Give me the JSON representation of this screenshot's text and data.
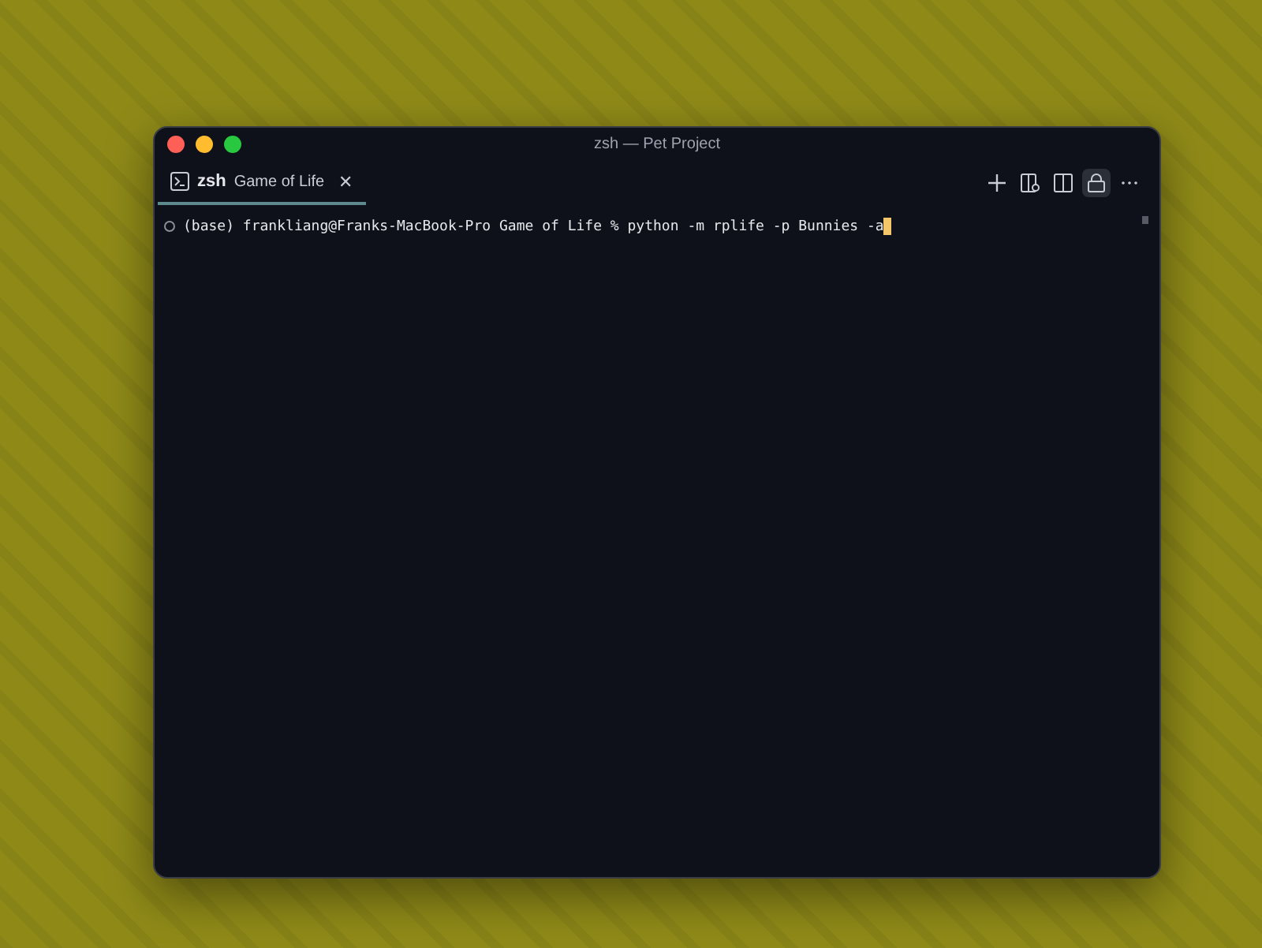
{
  "window": {
    "title": "zsh — Pet Project"
  },
  "tabs": [
    {
      "name": "zsh",
      "label": "Game of Life",
      "close": "✕",
      "selected": true
    }
  ],
  "toolbar": [
    {
      "kind": "plus",
      "on": false
    },
    {
      "kind": "split-config",
      "on": false
    },
    {
      "kind": "split",
      "on": false
    },
    {
      "kind": "lock",
      "on": true
    },
    {
      "kind": "more",
      "on": false
    }
  ],
  "terminal": {
    "lines": [
      {
        "text": "(base) frankliang@Franks-MacBook-Pro Game of Life % python -m rplife -p Bunnies -a",
        "cursor": true
      }
    ]
  }
}
